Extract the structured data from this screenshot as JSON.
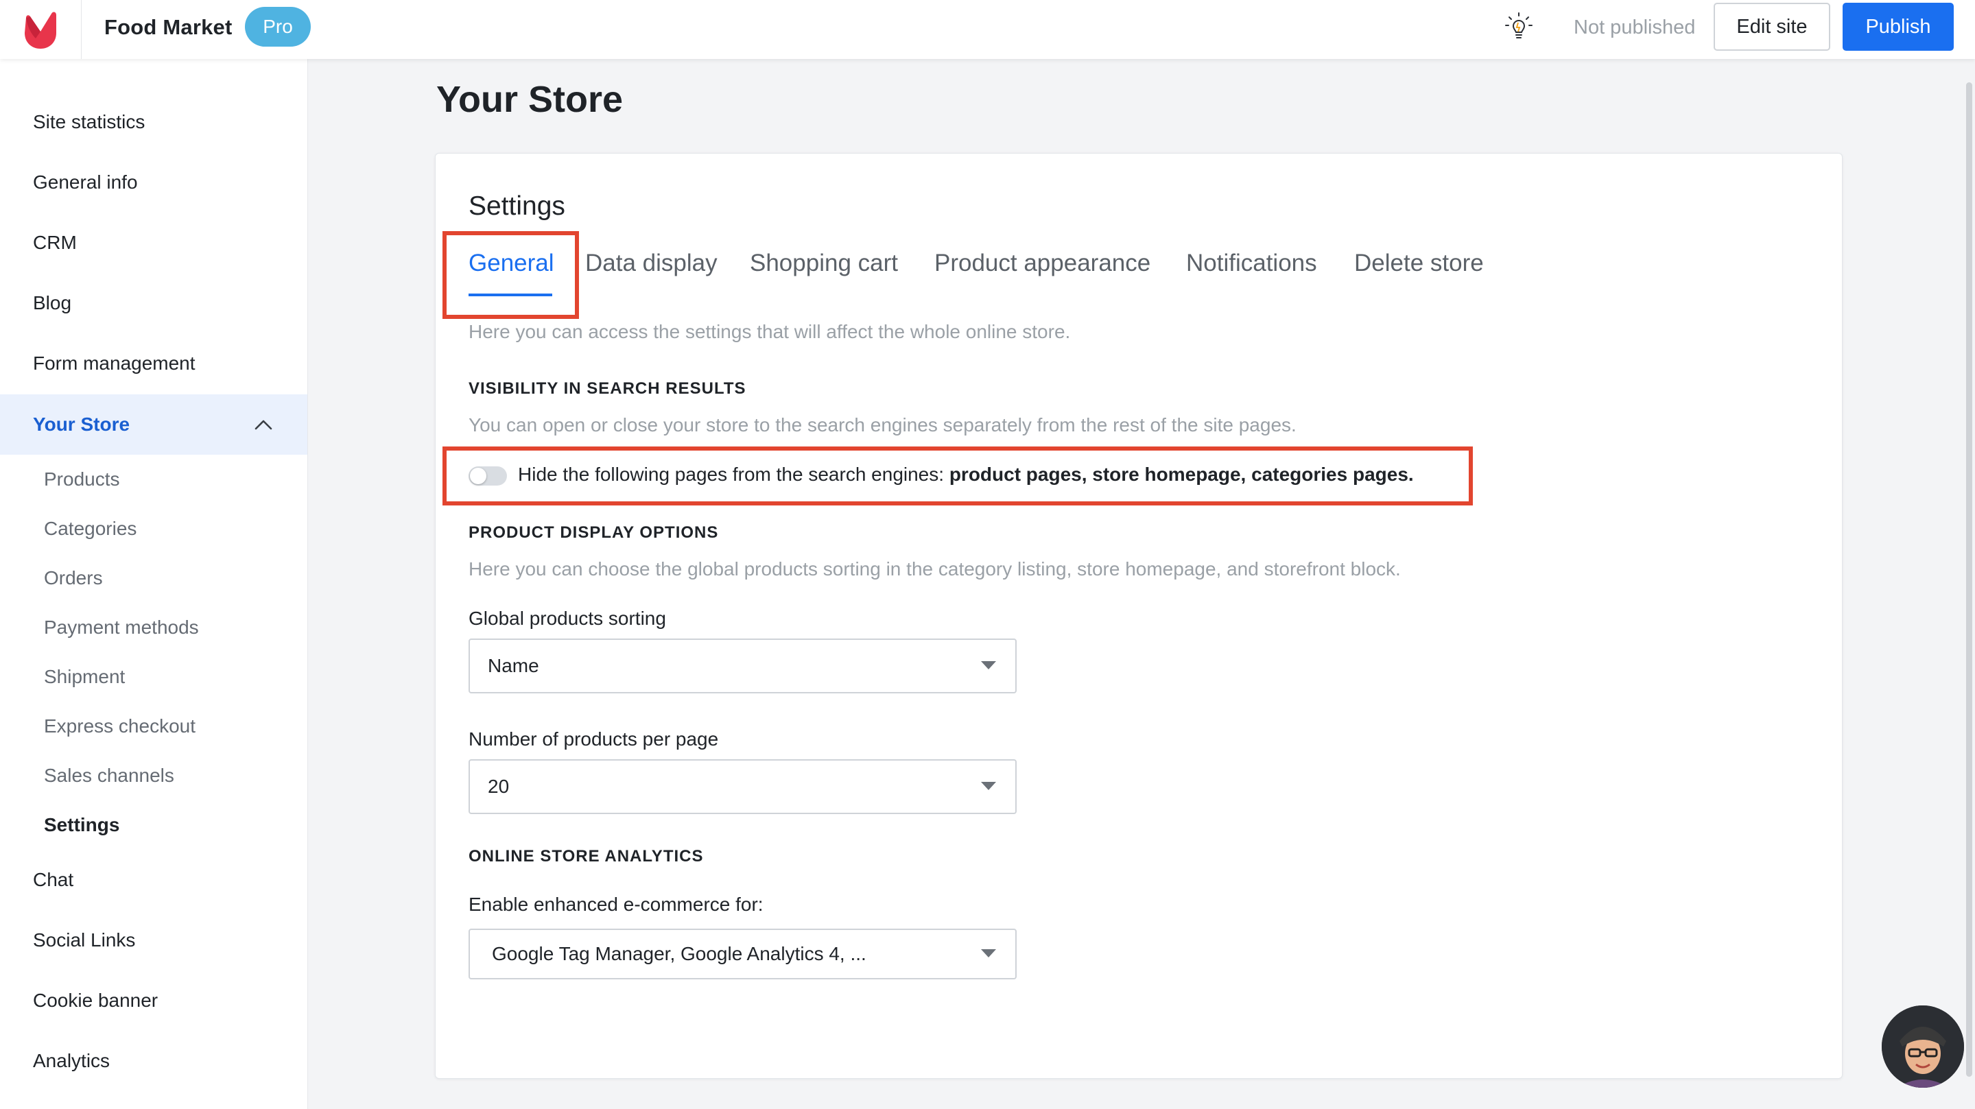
{
  "header": {
    "site_name": "Food Market",
    "plan_badge": "Pro",
    "status": "Not published",
    "edit_label": "Edit site",
    "publish_label": "Publish"
  },
  "sidebar": {
    "items": [
      {
        "label": "Site statistics"
      },
      {
        "label": "General info"
      },
      {
        "label": "CRM"
      },
      {
        "label": "Blog"
      },
      {
        "label": "Form management"
      },
      {
        "label": "Your Store",
        "active": true
      },
      {
        "label": "Chat"
      },
      {
        "label": "Social Links"
      },
      {
        "label": "Cookie banner"
      },
      {
        "label": "Analytics"
      }
    ],
    "store_subitems": [
      {
        "label": "Products"
      },
      {
        "label": "Categories"
      },
      {
        "label": "Orders"
      },
      {
        "label": "Payment methods"
      },
      {
        "label": "Shipment"
      },
      {
        "label": "Express checkout"
      },
      {
        "label": "Sales channels"
      },
      {
        "label": "Settings",
        "current": true
      }
    ]
  },
  "main": {
    "page_title": "Your Store",
    "card_title": "Settings",
    "tabs": [
      {
        "label": "General",
        "active": true
      },
      {
        "label": "Data display"
      },
      {
        "label": "Shopping cart"
      },
      {
        "label": "Product appearance"
      },
      {
        "label": "Notifications"
      },
      {
        "label": "Delete store"
      }
    ],
    "general_hint": "Here you can access the settings that will affect the whole online store.",
    "visibility": {
      "heading": "VISIBILITY IN SEARCH RESULTS",
      "hint": "You can open or close your store to the search engines separately from the rest of the site pages.",
      "toggle_prefix": "Hide the following pages from the search engines: ",
      "toggle_pages": "product pages, store homepage, categories pages.",
      "toggle_on": false
    },
    "display_options": {
      "heading": "PRODUCT DISPLAY OPTIONS",
      "hint": "Here you can choose the global products sorting in the category listing, store homepage, and storefront block.",
      "sorting_label": "Global products sorting",
      "sorting_value": "Name",
      "per_page_label": "Number of products per page",
      "per_page_value": "20"
    },
    "analytics": {
      "heading": "ONLINE STORE ANALYTICS",
      "ecommerce_label": "Enable enhanced e-commerce for:",
      "ecommerce_value": "Google Tag Manager, Google Analytics 4, ..."
    }
  },
  "colors": {
    "accent": "#1a6ff0",
    "highlight": "#e2452f",
    "badge": "#4fb3e1",
    "logo": "#e8354b"
  }
}
